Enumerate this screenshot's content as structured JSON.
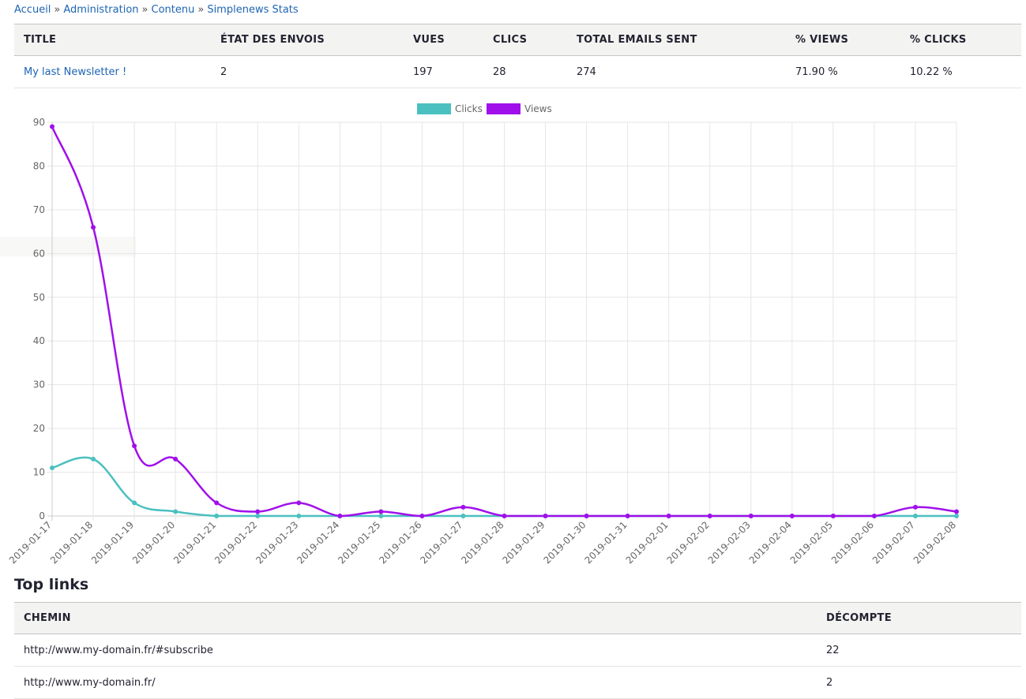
{
  "breadcrumb": {
    "items": [
      "Accueil",
      "Administration",
      "Contenu",
      "Simplenews Stats"
    ],
    "separator": "»"
  },
  "stats_table": {
    "headers": [
      "TITLE",
      "ÉTAT DES ENVOIS",
      "VUES",
      "CLICS",
      "TOTAL EMAILS SENT",
      "% VIEWS",
      "% CLICKS"
    ],
    "rows": [
      [
        "My last Newsletter !",
        "2",
        "197",
        "28",
        "274",
        "71.90 %",
        "10.22 %"
      ]
    ]
  },
  "chart_data": {
    "type": "line",
    "x": [
      "2019-01-17",
      "2019-01-18",
      "2019-01-19",
      "2019-01-20",
      "2019-01-21",
      "2019-01-22",
      "2019-01-23",
      "2019-01-24",
      "2019-01-25",
      "2019-01-26",
      "2019-01-27",
      "2019-01-28",
      "2019-01-29",
      "2019-01-30",
      "2019-01-31",
      "2019-02-01",
      "2019-02-02",
      "2019-02-03",
      "2019-02-04",
      "2019-02-05",
      "2019-02-06",
      "2019-02-07",
      "2019-02-08"
    ],
    "series": [
      {
        "name": "Clicks",
        "color": "#4bc0c0",
        "values": [
          11,
          13,
          3,
          1,
          0,
          0,
          0,
          0,
          0,
          0,
          0,
          0,
          0,
          0,
          0,
          0,
          0,
          0,
          0,
          0,
          0,
          0,
          0
        ]
      },
      {
        "name": "Views",
        "color": "#a010eb",
        "values": [
          89,
          66,
          16,
          13,
          3,
          1,
          3,
          0,
          1,
          0,
          2,
          0,
          0,
          0,
          0,
          0,
          0,
          0,
          0,
          0,
          0,
          2,
          1
        ]
      }
    ],
    "yticks": [
      0,
      10,
      20,
      30,
      40,
      50,
      60,
      70,
      80,
      90
    ],
    "ylim": [
      0,
      90
    ],
    "grid": true,
    "legend": "top-center"
  },
  "top_links": {
    "title": "Top links",
    "headers": [
      "CHEMIN",
      "DÉCOMPTE"
    ],
    "rows": [
      [
        "http://www.my-domain.fr/#subscribe",
        "22"
      ],
      [
        "http://www.my-domain.fr/",
        "2"
      ]
    ]
  }
}
